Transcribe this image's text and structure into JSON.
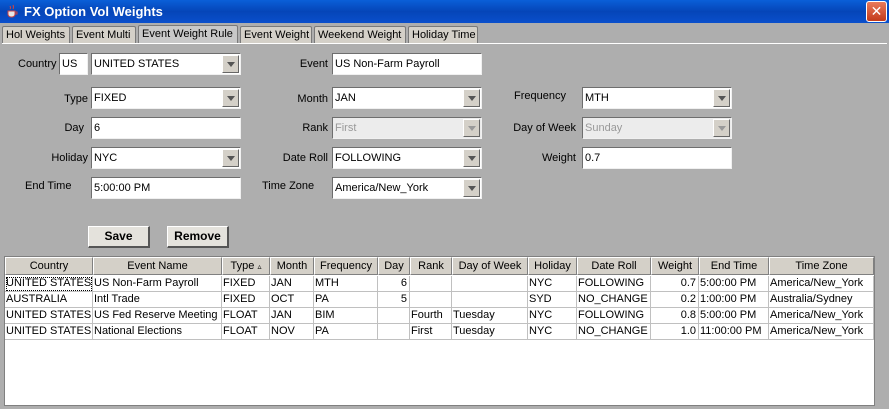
{
  "window": {
    "title": "FX Option Vol Weights"
  },
  "tabs": [
    {
      "label": "Hol Weights"
    },
    {
      "label": "Event Multi"
    },
    {
      "label": "Event Weight Rule"
    },
    {
      "label": "Event Weight"
    },
    {
      "label": "Weekend Weight"
    },
    {
      "label": "Holiday Time"
    }
  ],
  "form": {
    "country_label": "Country",
    "country_code": "US",
    "country_name": "UNITED STATES",
    "event_label": "Event",
    "event_value": "US Non-Farm Payroll",
    "type_label": "Type",
    "type_value": "FIXED",
    "month_label": "Month",
    "month_value": "JAN",
    "frequency_label": "Frequency",
    "frequency_value": "MTH",
    "day_label": "Day",
    "day_value": "6",
    "rank_label": "Rank",
    "rank_value": "First",
    "dow_label": "Day of Week",
    "dow_value": "Sunday",
    "holiday_label": "Holiday",
    "holiday_value": "NYC",
    "dateroll_label": "Date Roll",
    "dateroll_value": "FOLLOWING",
    "weight_label": "Weight",
    "weight_value": "0.7",
    "endtime_label": "End Time",
    "endtime_value": "5:00:00 PM",
    "timezone_label": "Time Zone",
    "timezone_value": "America/New_York"
  },
  "buttons": {
    "save": "Save",
    "remove": "Remove"
  },
  "table": {
    "columns": [
      "Country",
      "Event Name",
      "Type",
      "Month",
      "Frequency",
      "Day",
      "Rank",
      "Day of Week",
      "Holiday",
      "Date Roll",
      "Weight",
      "End Time",
      "Time Zone"
    ],
    "sort_indicator": "▵",
    "rows": [
      [
        "UNITED STATES",
        "US Non-Farm Payroll",
        "FIXED",
        "JAN",
        "MTH",
        "6",
        "",
        "",
        "NYC",
        "FOLLOWING",
        "0.7",
        "5:00:00 PM",
        "America/New_York"
      ],
      [
        "AUSTRALIA",
        "Intl Trade",
        "FIXED",
        "OCT",
        "PA",
        "5",
        "",
        "",
        "SYD",
        "NO_CHANGE",
        "0.2",
        "1:00:00 PM",
        "Australia/Sydney"
      ],
      [
        "UNITED STATES",
        "US Fed Reserve Meeting",
        "FLOAT",
        "JAN",
        "BIM",
        "",
        "Fourth",
        "Tuesday",
        "NYC",
        "FOLLOWING",
        "0.8",
        "5:00:00 PM",
        "America/New_York"
      ],
      [
        "UNITED STATES",
        "National Elections",
        "FLOAT",
        "NOV",
        "PA",
        "",
        "First",
        "Tuesday",
        "NYC",
        "NO_CHANGE",
        "1.0",
        "11:00:00 PM",
        "America/New_York"
      ]
    ]
  },
  "colors": {
    "titlebar": "#0545b8",
    "window_bg": "#aeaeae",
    "close_button": "#c33a1a"
  },
  "icons": {
    "app": "java-cup-icon",
    "close": "close-icon",
    "dropdown": "chevron-down-icon"
  }
}
